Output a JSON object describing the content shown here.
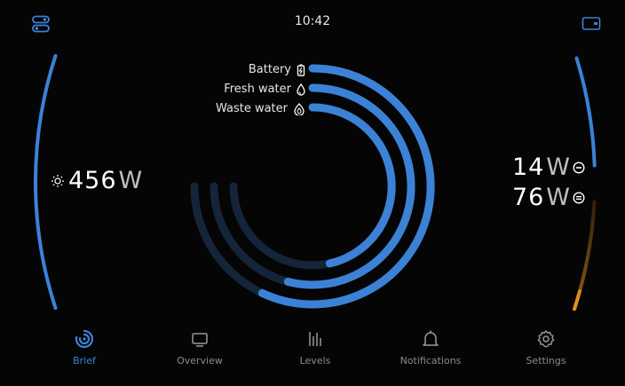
{
  "header": {
    "time": "10:42",
    "menu_icon": "toggle-menu-icon",
    "window_icon": "window-icon"
  },
  "solar": {
    "icon": "sun-icon",
    "value": "456",
    "unit": "W"
  },
  "dc_loads": [
    {
      "value": "14",
      "unit": "W",
      "icon": "minus-circle-icon"
    },
    {
      "value": "76",
      "unit": "W",
      "icon": "equals-circle-icon"
    }
  ],
  "tanks": [
    {
      "label": "Battery",
      "icon": "battery-icon",
      "level": 0.76
    },
    {
      "label": "Fresh water",
      "icon": "drop-icon",
      "level": 0.72
    },
    {
      "label": "Waste water",
      "icon": "waste-drop-icon",
      "level": 0.62
    }
  ],
  "gauges": {
    "left_solar_level": 1.0,
    "right_top_level": 1.0,
    "right_bottom_level": 0.17
  },
  "colors": {
    "accent": "#3b82d6",
    "track": "#14253a",
    "orange": "#e39322"
  },
  "nav": {
    "items": [
      {
        "label": "Brief",
        "icon": "brief-icon",
        "active": true
      },
      {
        "label": "Overview",
        "icon": "overview-icon",
        "active": false
      },
      {
        "label": "Levels",
        "icon": "levels-icon",
        "active": false
      },
      {
        "label": "Notifications",
        "icon": "bell-icon",
        "active": false
      },
      {
        "label": "Settings",
        "icon": "gear-icon",
        "active": false
      }
    ]
  }
}
